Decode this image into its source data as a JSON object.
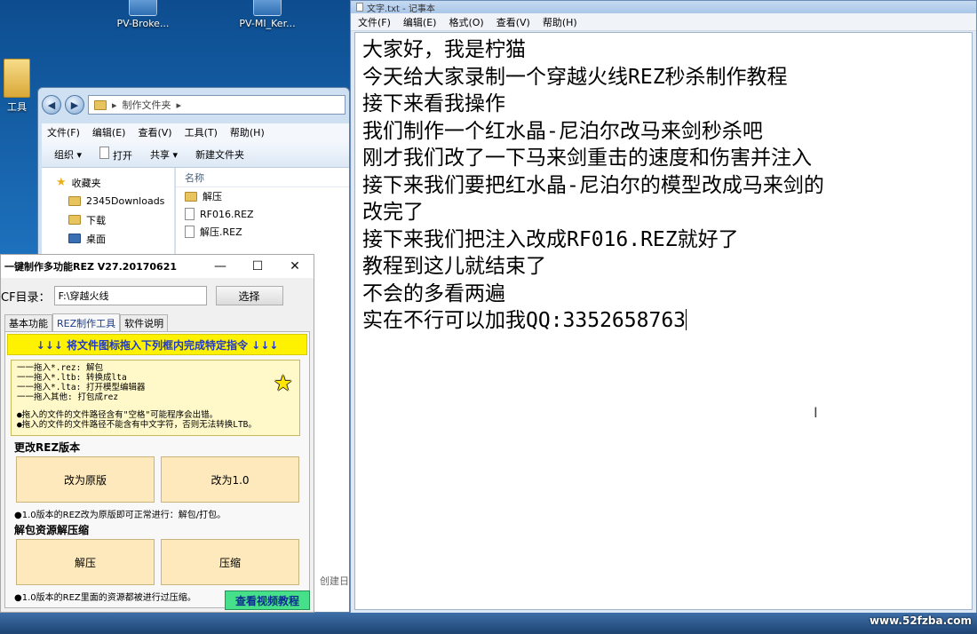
{
  "desktop": {
    "icons": [
      "PV-Broke...",
      "PV-MI_Ker...",
      "工具"
    ]
  },
  "explorer": {
    "address": "制作文件夹",
    "menu": [
      "文件(F)",
      "编辑(E)",
      "查看(V)",
      "工具(T)",
      "帮助(H)"
    ],
    "toolbar": {
      "organize": "组织 ▾",
      "open": "打开",
      "share": "共享 ▾",
      "new_folder": "新建文件夹"
    },
    "sidebar": [
      "收藏夹",
      "2345Downloads",
      "下载",
      "桌面"
    ],
    "column_name": "名称",
    "files": [
      "解压",
      "RF016.REZ",
      "解压.REZ"
    ],
    "footer": "创建日"
  },
  "tool": {
    "title": "一键制作多功能REZ V27.20170621",
    "cf_label": "CF目录：",
    "cf_path": "F:\\穿越火线",
    "browse_label": "选择",
    "tabs": [
      "基本功能",
      "REZ制作工具",
      "软件说明"
    ],
    "banner": "↓↓↓ 将文件图标拖入下列框内完成特定指令 ↓↓↓",
    "drop_lines": [
      "一一拖入*.rez: 解包",
      "一一拖入*.ltb: 转换成lta",
      "一一拖入*.lta: 打开模型编辑器",
      "一一拖入其他: 打包成rez"
    ],
    "drop_notes": [
      "●拖入的文件的文件路径含有\"空格\"可能程序会出错。",
      "●拖入的文件的文件路径不能含有中文字符，否则无法转换LTB。"
    ],
    "section_version": "更改REZ版本",
    "btn_original": "改为原版",
    "btn_v10": "改为1.0",
    "note_version": "●1.0版本的REZ改为原版即可正常进行：解包/打包。",
    "section_unpack": "解包资源解压缩",
    "btn_unpack": "解压",
    "btn_compress": "压缩",
    "note_unpack": "●1.0版本的REZ里面的资源都被进行过压缩。",
    "video_label": "查看视频教程"
  },
  "notepad": {
    "title": "文字.txt - 记事本",
    "menu": [
      "文件(F)",
      "编辑(E)",
      "格式(O)",
      "查看(V)",
      "帮助(H)"
    ],
    "lines": [
      "大家好，我是柠猫",
      "今天给大家录制一个穿越火线REZ秒杀制作教程",
      "接下来看我操作",
      "我们制作一个红水晶-尼泊尔改马来剑秒杀吧",
      "刚才我们改了一下马来剑重击的速度和伤害并注入",
      "接下来我们要把红水晶-尼泊尔的模型改成马来剑的",
      "改完了",
      "接下来我们把注入改成RF016.REZ就好了",
      "教程到这儿就结束了",
      "不会的多看两遍",
      "实在不行可以加我QQ:3352658763"
    ]
  },
  "watermark": "www.52fzba.com"
}
